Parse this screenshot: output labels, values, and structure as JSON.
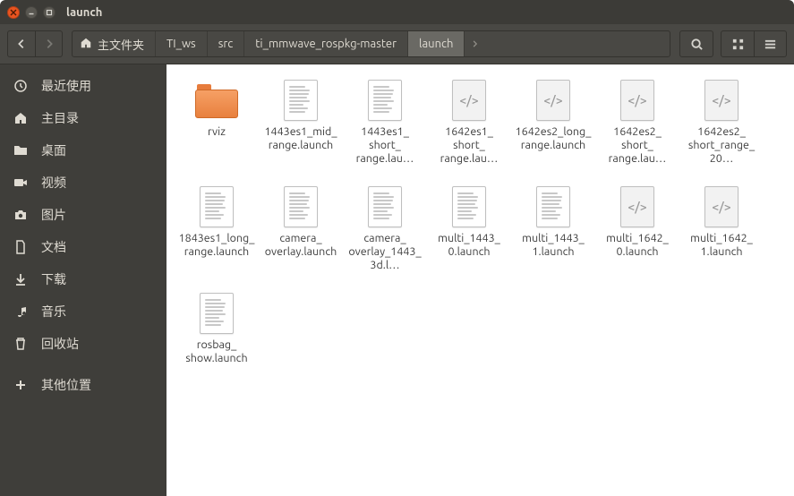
{
  "window": {
    "title": "launch"
  },
  "path": {
    "home": "主文件夹",
    "segments": [
      "TI_ws",
      "src",
      "ti_mmwave_rospkg-master",
      "launch"
    ],
    "activeIndex": 3
  },
  "sidebar": {
    "items": [
      {
        "icon": "clock",
        "label": "最近使用"
      },
      {
        "icon": "home",
        "label": "主目录"
      },
      {
        "icon": "folder",
        "label": "桌面"
      },
      {
        "icon": "video",
        "label": "视频"
      },
      {
        "icon": "camera",
        "label": "图片"
      },
      {
        "icon": "doc",
        "label": "文档"
      },
      {
        "icon": "download",
        "label": "下载"
      },
      {
        "icon": "music",
        "label": "音乐"
      },
      {
        "icon": "trash",
        "label": "回收站"
      },
      {
        "icon": "plus",
        "label": "其他位置"
      }
    ]
  },
  "files": [
    {
      "type": "folder",
      "name": "rviz"
    },
    {
      "type": "text",
      "name": "1443es1_mid_range.launch"
    },
    {
      "type": "text",
      "name": "1443es1_short_range.lau…"
    },
    {
      "type": "xml",
      "name": "1642es1_short_range.lau…"
    },
    {
      "type": "xml",
      "name": "1642es2_long_range.launch"
    },
    {
      "type": "xml",
      "name": "1642es2_short_range.lau…"
    },
    {
      "type": "xml",
      "name": "1642es2_short_range_20…"
    },
    {
      "type": "text",
      "name": "1843es1_long_range.launch"
    },
    {
      "type": "text",
      "name": "camera_overlay.launch"
    },
    {
      "type": "text",
      "name": "camera_overlay_1443_3d.l…"
    },
    {
      "type": "text",
      "name": "multi_1443_0.launch"
    },
    {
      "type": "text",
      "name": "multi_1443_1.launch"
    },
    {
      "type": "xml",
      "name": "multi_1642_0.launch"
    },
    {
      "type": "xml",
      "name": "multi_1642_1.launch"
    },
    {
      "type": "text",
      "name": "rosbag_show.launch"
    }
  ]
}
